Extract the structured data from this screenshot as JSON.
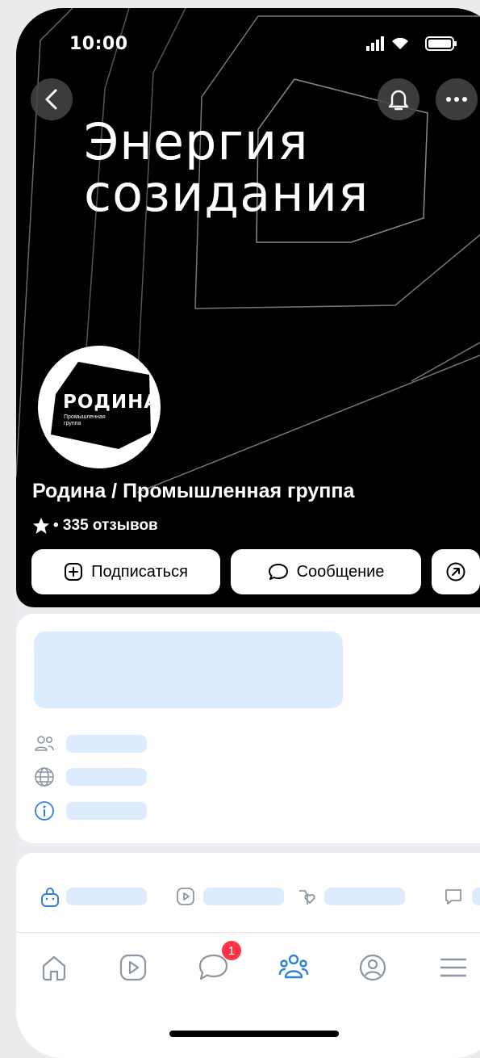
{
  "status": {
    "time": "10:00"
  },
  "cover": {
    "title": "Энергия\nсозидания"
  },
  "logo": {
    "name": "РОДИНА",
    "subtitle": "Промышленная группа"
  },
  "community": {
    "name": "Родина / Промышленная группа",
    "reviews": "• 335 отзывов"
  },
  "actions": {
    "subscribe": "Подписаться",
    "message": "Сообщение"
  },
  "tabbar": {
    "messages_badge": "1",
    "active_tab": "communities"
  },
  "colors": {
    "accent": "#2d81e0",
    "skeleton": "#dcebfd",
    "badge": "#ff3347"
  }
}
